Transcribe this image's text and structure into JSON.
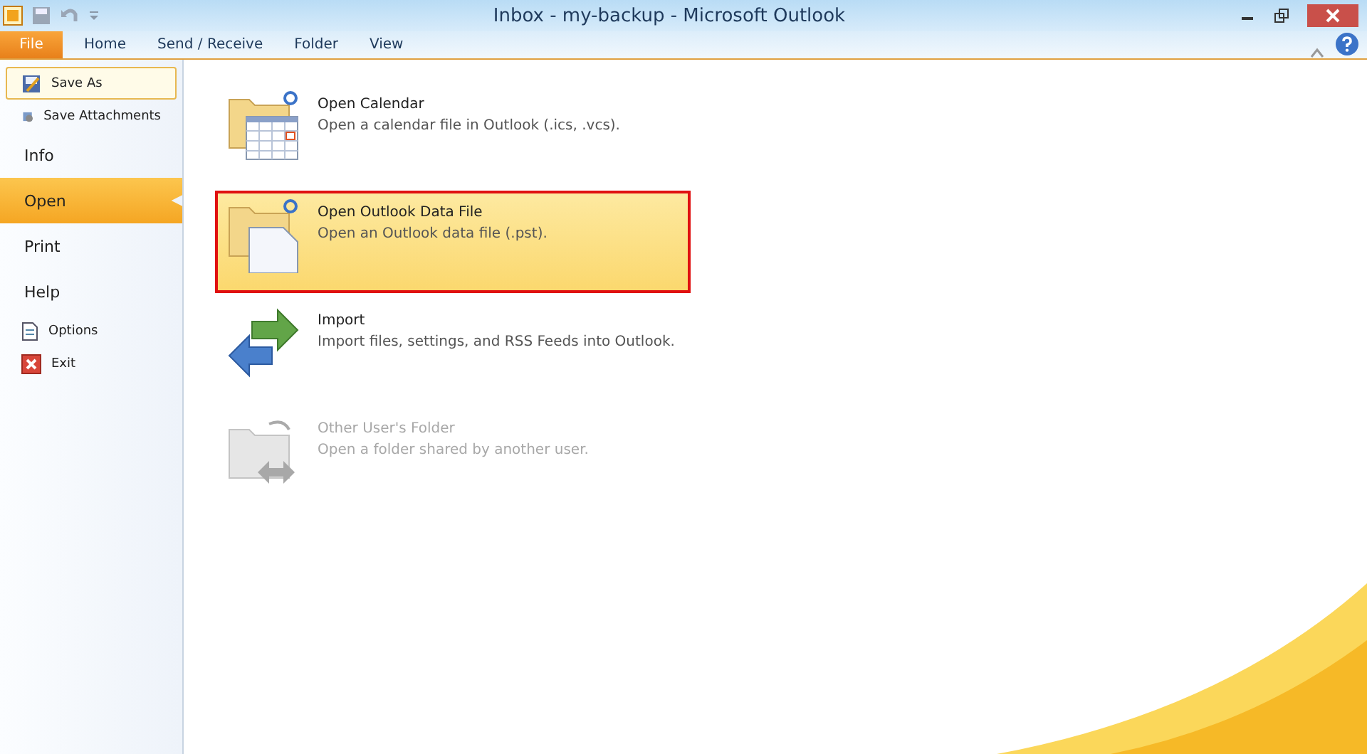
{
  "window": {
    "title": "Inbox - my-backup - Microsoft Outlook"
  },
  "ribbon_tabs": [
    {
      "label": "File",
      "selected": true
    },
    {
      "label": "Home",
      "selected": false
    },
    {
      "label": "Send / Receive",
      "selected": false
    },
    {
      "label": "Folder",
      "selected": false
    },
    {
      "label": "View",
      "selected": false
    }
  ],
  "sidebar": {
    "items": [
      {
        "kind": "command",
        "label": "Save As",
        "selected": false,
        "focused": true
      },
      {
        "kind": "command",
        "label": "Save Attachments",
        "selected": false,
        "focused": false
      },
      {
        "kind": "section",
        "label": "Info",
        "selected": false
      },
      {
        "kind": "section",
        "label": "Open",
        "selected": true
      },
      {
        "kind": "section",
        "label": "Print",
        "selected": false
      },
      {
        "kind": "section",
        "label": "Help",
        "selected": false
      },
      {
        "kind": "command",
        "label": "Options",
        "selected": false,
        "focused": false
      },
      {
        "kind": "command",
        "label": "Exit",
        "selected": false,
        "focused": false
      }
    ]
  },
  "open_options": [
    {
      "title": "Open Calendar",
      "description": "Open a calendar file in Outlook (.ics, .vcs).",
      "selected": false,
      "disabled": false
    },
    {
      "title": "Open Outlook Data File",
      "description": "Open an Outlook data file (.pst).",
      "selected": true,
      "disabled": false
    },
    {
      "title": "Import",
      "description": "Import files, settings, and RSS Feeds into Outlook.",
      "selected": false,
      "disabled": false
    },
    {
      "title": "Other User's Folder",
      "description": "Open a folder shared by another user.",
      "selected": false,
      "disabled": true
    }
  ]
}
